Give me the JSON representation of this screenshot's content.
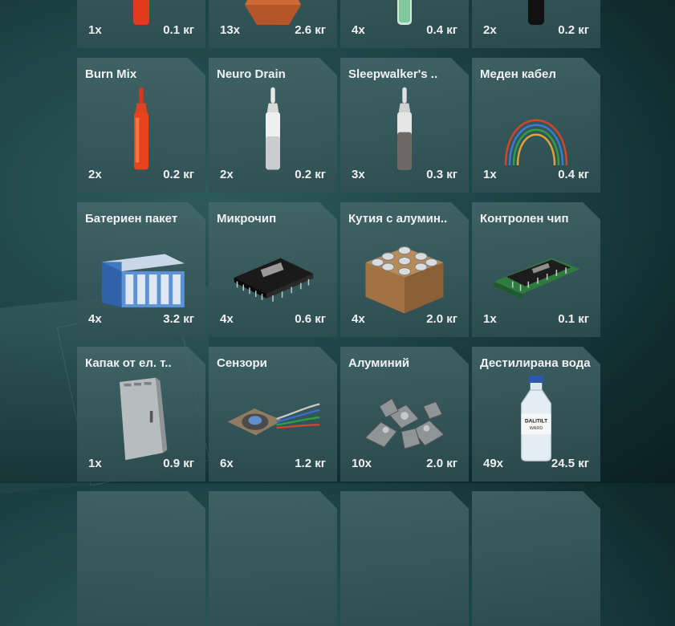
{
  "items": [
    {
      "name": "",
      "qty": "1x",
      "weight": "0.1 кг",
      "icon": "red-ampoule-icon"
    },
    {
      "name": "",
      "qty": "13x",
      "weight": "2.6 кг",
      "icon": "copper-ingot-icon"
    },
    {
      "name": "",
      "qty": "4x",
      "weight": "0.4 кг",
      "icon": "green-vial-icon"
    },
    {
      "name": "",
      "qty": "2x",
      "weight": "0.2 кг",
      "icon": "black-bottle-icon"
    },
    {
      "name": "Burn Mix",
      "qty": "2x",
      "weight": "0.2 кг",
      "icon": "red-ampoule-icon"
    },
    {
      "name": "Neuro Drain",
      "qty": "2x",
      "weight": "0.2 кг",
      "icon": "clear-ampoule-icon"
    },
    {
      "name": "Sleepwalker's ..",
      "qty": "3x",
      "weight": "0.3 кг",
      "icon": "grey-ampoule-icon"
    },
    {
      "name": "Меден кабел",
      "qty": "1x",
      "weight": "0.4 кг",
      "icon": "copper-cable-icon"
    },
    {
      "name": "Батериен пакет",
      "qty": "4x",
      "weight": "3.2 кг",
      "icon": "battery-pack-icon"
    },
    {
      "name": "Микрочип",
      "qty": "4x",
      "weight": "0.6 кг",
      "icon": "microchip-icon"
    },
    {
      "name": "Кутия с алумин..",
      "qty": "4x",
      "weight": "2.0 кг",
      "icon": "aluminum-box-icon"
    },
    {
      "name": "Контролен чип",
      "qty": "1x",
      "weight": "0.1 кг",
      "icon": "control-chip-icon"
    },
    {
      "name": "Капак от ел. т..",
      "qty": "1x",
      "weight": "0.9 кг",
      "icon": "panel-door-icon"
    },
    {
      "name": "Сензори",
      "qty": "6x",
      "weight": "1.2 кг",
      "icon": "sensor-icon"
    },
    {
      "name": "Алуминий",
      "qty": "10x",
      "weight": "2.0 кг",
      "icon": "aluminum-scrap-icon"
    },
    {
      "name": "Дестилирана вода",
      "qty": "49x",
      "weight": "24.5 кг",
      "icon": "water-bottle-icon"
    },
    {
      "name": "",
      "qty": "",
      "weight": "",
      "icon": ""
    },
    {
      "name": "",
      "qty": "",
      "weight": "",
      "icon": ""
    },
    {
      "name": "",
      "qty": "",
      "weight": "",
      "icon": ""
    },
    {
      "name": "",
      "qty": "",
      "weight": "",
      "icon": ""
    }
  ],
  "bottle_label": [
    "DALITILT",
    "WARD"
  ]
}
